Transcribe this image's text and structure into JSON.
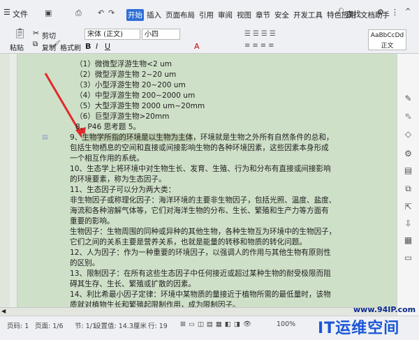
{
  "menubar": {
    "file_label": "文件",
    "tabs": [
      "开始",
      "插入",
      "页面布局",
      "引用",
      "审阅",
      "视图",
      "章节",
      "安全",
      "开发工具",
      "特色应用",
      "文档助手"
    ],
    "active_tab": "开始",
    "search_label": "查找"
  },
  "ribbon": {
    "cut": "剪切",
    "copy": "复制",
    "paste": "粘贴",
    "format_painter": "格式刷",
    "font_name": "宋体 (正文)",
    "font_size": "小四",
    "style_preview": "AaBbCcDd",
    "style_name": "正文"
  },
  "document": {
    "lines": [
      "（1）微微型浮游生物<2 um",
      "（2）微型浮游生物 2~20 um",
      "（3）小型浮游生物 20~200 um",
      "（4）中型浮游生物 200~2000 um",
      "（5）大型浮游生物 2000 um~20mm",
      "（6）巨型浮游生物>20mm",
      "8、P46 思考题 5。",
      "9、生物学所指的环境是以生物为主体，环境就是生物之外所有自然条件的总和，",
      "包括生物栖息的空间和直接或间接影响生物的各种环境因素，这些因素本身形成",
      "一个相互作用的系统。",
      "10、生态学上将环境中对生物生长、发育、生殖、行为和分布有直接或间接影响",
      "的环境要素，称为生态因子。",
      "11、生态因子可以分为两大类：",
      "非生物因子或称理化因子：海洋环境的主要非生物因子，包括光照、温度、盐度、",
      "海流和各种溶解气体等，它们对海洋生物的分布、生长、繁殖和生产力等方面有",
      "重要的影响。",
      "生物因子：生物周围的同种或异种的其他生物，各种生物互为环境中的生物因子，",
      "它们之间的关系主要是营养关系，也就是能量的转移和物质的转化问题。",
      "12、人为因子：作为一种重要的环境因子，以强调人的作用与其他生物有原则性",
      "的区别。",
      "13、限制因子：在所有这些生态因子中任何接近或超过某种生物的耐受极限而阻",
      "碍其生存、生长、繁殖或扩散的因素。",
      "14、利比希最小因子定律：环境中某物质的量接近于植物所需的最低量时，该物",
      "质就对植物生长和繁殖起限制作用，成为限制因子。"
    ],
    "highlight_line": 7,
    "highlight_text": "生物学所指的环境是以生物为主体"
  },
  "status": {
    "page": "页码: 1",
    "pages": "页面: 1/6",
    "section": "节: 1/1",
    "setting": "设置值: 14.3厘米",
    "row": "行: 19",
    "zoom": "100%"
  },
  "watermark": {
    "url": "www.94IP.com",
    "title": "IT运维空间"
  }
}
